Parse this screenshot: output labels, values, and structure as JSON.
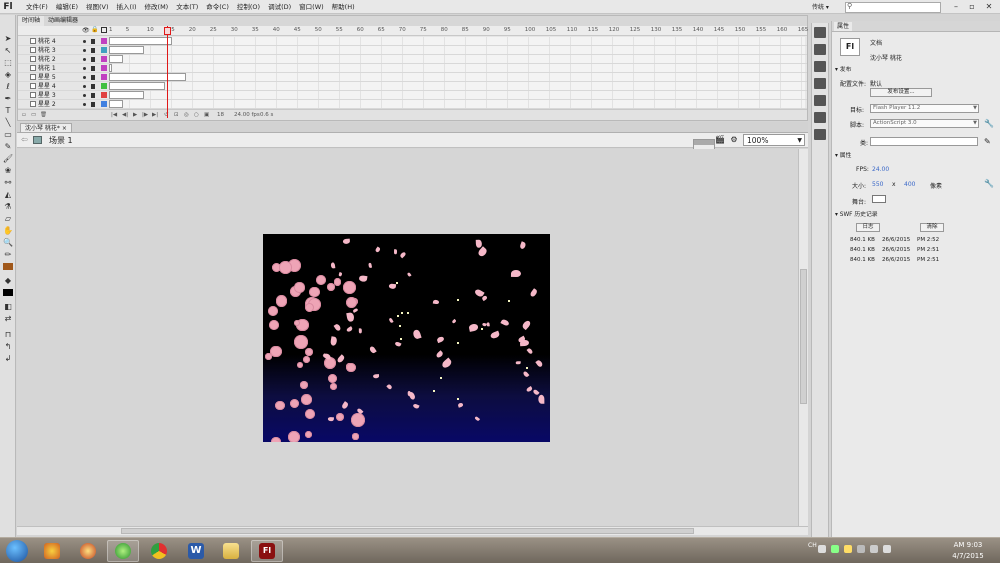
{
  "app": {
    "logo": "Fl"
  },
  "menubar": {
    "items": [
      "文件(F)",
      "编辑(E)",
      "视图(V)",
      "插入(I)",
      "修改(M)",
      "文本(T)",
      "命令(C)",
      "控制(O)",
      "调试(D)",
      "窗口(W)",
      "帮助(H)"
    ],
    "workspace": "传统 ▾"
  },
  "timeline": {
    "tabs": [
      "时间轴",
      "动画编辑器"
    ],
    "frame_numbers": [
      "1",
      "5",
      "10",
      "15",
      "20",
      "25",
      "30",
      "35",
      "40",
      "45",
      "50",
      "55",
      "60",
      "65",
      "70",
      "75",
      "80",
      "85",
      "90",
      "95",
      "100",
      "105",
      "110",
      "115",
      "120",
      "125",
      "130",
      "135",
      "140",
      "145",
      "150",
      "155",
      "160",
      "165"
    ],
    "layers": [
      {
        "name": "桃花 4",
        "color": "#c040c0",
        "frames": 0.09
      },
      {
        "name": "桃花 3",
        "color": "#40a0c0",
        "frames": 0.05
      },
      {
        "name": "桃花 2",
        "color": "#c040c0",
        "frames": 0.02
      },
      {
        "name": "桃花 1",
        "color": "#c040c0",
        "frames": 0.0
      },
      {
        "name": "星星 5",
        "color": "#c040c0",
        "frames": 0.11
      },
      {
        "name": "星星 4",
        "color": "#40c040",
        "frames": 0.08
      },
      {
        "name": "星星 3",
        "color": "#e04040",
        "frames": 0.05
      },
      {
        "name": "星星 2",
        "color": "#4080e0",
        "frames": 0.02
      }
    ],
    "footer": {
      "frame": "18",
      "fps": "24.00 fps",
      "time": "0.6 s"
    }
  },
  "document": {
    "tab": "沈小琴 桃花*",
    "scene": "场景 1",
    "zoom": "100%"
  },
  "properties": {
    "tab": "属性",
    "doc_type": "文档",
    "doc_name": "沈小琴 桃花",
    "publish_header": "发布",
    "profile_label": "配置文件:",
    "profile_value": "默认",
    "publish_settings": "发布设置...",
    "target_label": "目标:",
    "target_value": "Flash Player 11.2",
    "script_label": "脚本:",
    "script_value": "ActionScript 3.0",
    "class_label": "类:",
    "class_value": "",
    "props_header": "属性",
    "fps_label": "FPS:",
    "fps_value": "24.00",
    "size_label": "大小:",
    "width": "550",
    "x_sep": "x",
    "height": "400",
    "unit": "像素",
    "stage_label": "舞台:",
    "swf_header": "SWF 历史记录",
    "log_button": "日志",
    "clear_button": "清除",
    "history": [
      {
        "size": "840.1 KB",
        "date": "26/6/2015",
        "time": "PM 2:52"
      },
      {
        "size": "840.1 KB",
        "date": "26/6/2015",
        "time": "PM 2:51"
      },
      {
        "size": "840.1 KB",
        "date": "26/6/2015",
        "time": "PM 2:51"
      }
    ]
  },
  "taskbar": {
    "tray_lang": "CH",
    "time": "AM 9:03",
    "date": "4/7/2015"
  },
  "colors": {
    "accent": "#3a68c8",
    "playhead": "#e01818",
    "stage_top": "#000000",
    "stage_bottom": "#080866"
  }
}
